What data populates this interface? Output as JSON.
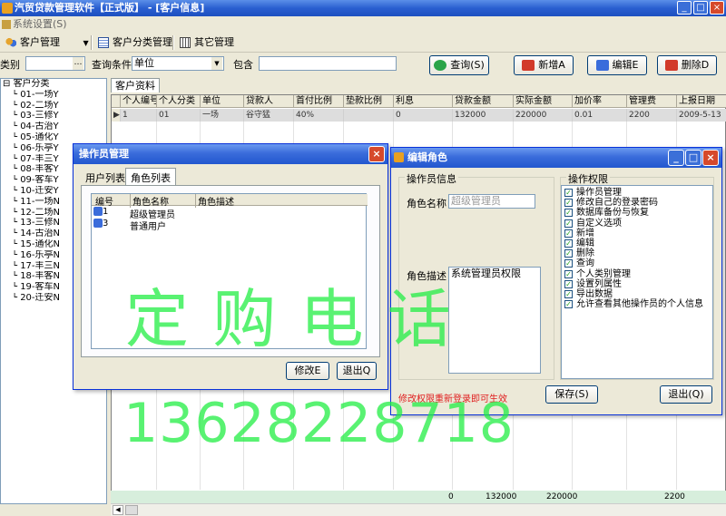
{
  "window": {
    "title": "汽贸贷款管理软件【正式版】 - [客户信息]"
  },
  "menu": {
    "system": "系统设置(S)"
  },
  "toolbar": {
    "customer_mgmt": "客户管理",
    "category_mgmt": "客户分类管理",
    "other_mgmt": "其它管理"
  },
  "search": {
    "category_label": "类别",
    "condition_label": "查询条件",
    "condition_value": "单位",
    "contains_label": "包含",
    "query_btn": "查询(S)",
    "add_btn": "新增A",
    "edit_btn": "编辑E",
    "delete_btn": "删除D"
  },
  "tree": {
    "root": "客户分类",
    "items": [
      "01-一场Y",
      "02-二场Y",
      "03-三修Y",
      "04-古治Y",
      "05-通化Y",
      "06-乐亭Y",
      "07-丰三Y",
      "08-丰客Y",
      "09-客车Y",
      "10-迁安Y",
      "11-一场N",
      "12-二场N",
      "13-三修N",
      "14-古治N",
      "15-通化N",
      "16-乐亭N",
      "17-丰三N",
      "18-丰客N",
      "19-客车N",
      "20-迁安N"
    ]
  },
  "tab": {
    "label": "客户资料"
  },
  "grid": {
    "columns": [
      "个人编号",
      "个人分类",
      "单位",
      "贷款人",
      "首付比例",
      "垫款比例",
      "利息",
      "贷款金额",
      "实际金额",
      "加价率",
      "管理费",
      "上报日期"
    ],
    "row": [
      "1",
      "01",
      "一场",
      "谷守猛",
      "40%",
      "",
      "0",
      "132000",
      "220000",
      "0.01",
      "2200",
      "2009-5-13"
    ],
    "totals": {
      "interest": "0",
      "loan": "132000",
      "actual": "220000",
      "fee": "2200"
    }
  },
  "operator_dialog": {
    "title": "操作员管理",
    "tabs": [
      "用户列表",
      "角色列表"
    ],
    "columns": [
      "编号",
      "角色名称",
      "角色描述"
    ],
    "rows": [
      {
        "id": "1",
        "name": "超级管理员",
        "desc": ""
      },
      {
        "id": "3",
        "name": "普通用户",
        "desc": ""
      }
    ],
    "modify_btn": "修改E",
    "exit_btn": "退出Q"
  },
  "role_dialog": {
    "title": "编辑角色",
    "info_group": "操作员信息",
    "role_name_label": "角色名称",
    "role_name_value": "超级管理员",
    "role_desc_label": "角色描述",
    "role_desc_value": "系统管理员权限",
    "perm_group": "操作权限",
    "permissions": [
      "操作员管理",
      "修改自己的登录密码",
      "数据库备份与恢复",
      "自定义选项",
      "新增",
      "编辑",
      "删除",
      "查询",
      "个人类别管理",
      "设置列属性",
      "导出数据",
      "允许查看其他操作员的个人信息"
    ],
    "note": "修改权限重新登录即可生效",
    "save_btn": "保存(S)",
    "exit_btn": "退出(Q)"
  },
  "watermark": {
    "line1": "定 购 电 话",
    "line2": "13628228718"
  },
  "colors": {
    "title_blue": "#2a5fd0",
    "watermark_green": "#22ee44",
    "note_red": "#e02020"
  }
}
